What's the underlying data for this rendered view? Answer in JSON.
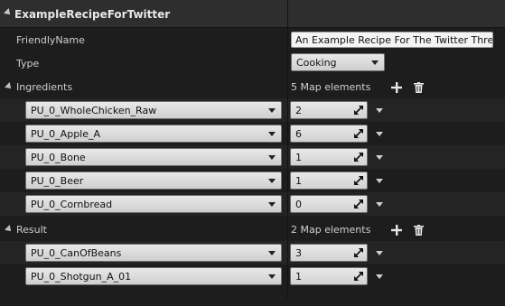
{
  "panel": {
    "title": "ExampleRecipeForTwitter"
  },
  "friendly_name": {
    "label": "FriendlyName",
    "value": "An Example Recipe For The Twitter Thread"
  },
  "type": {
    "label": "Type",
    "value": "Cooking"
  },
  "ingredients": {
    "label": "Ingredients",
    "count": "5 Map elements",
    "items": [
      {
        "key": "PU_0_WholeChicken_Raw",
        "value": "2"
      },
      {
        "key": "PU_0_Apple_A",
        "value": "6"
      },
      {
        "key": "PU_0_Bone",
        "value": "1"
      },
      {
        "key": "PU_0_Beer",
        "value": "1"
      },
      {
        "key": "PU_0_Cornbread",
        "value": "0"
      }
    ]
  },
  "result": {
    "label": "Result",
    "count": "2 Map elements",
    "items": [
      {
        "key": "PU_0_CanOfBeans",
        "value": "3"
      },
      {
        "key": "PU_0_Shotgun_A_01",
        "value": "1"
      }
    ]
  }
}
